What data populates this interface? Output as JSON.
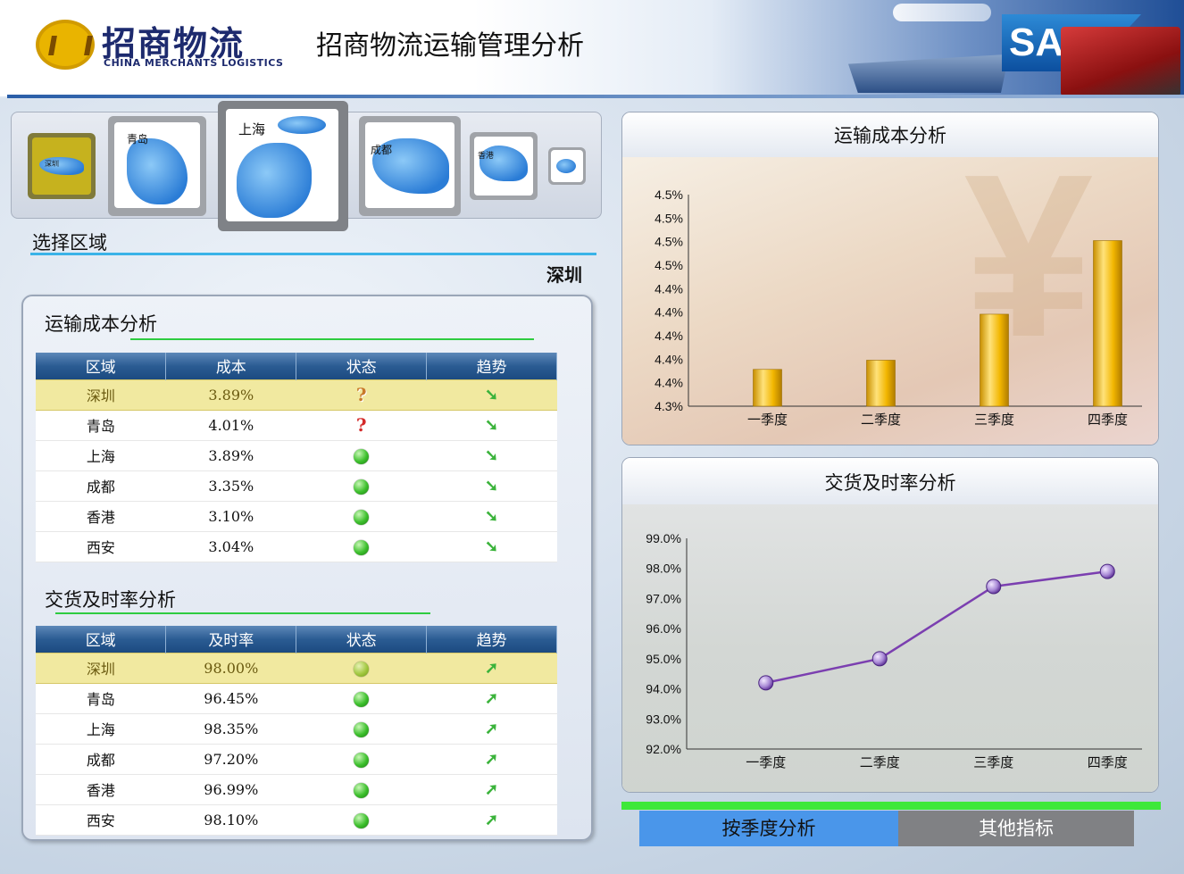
{
  "header": {
    "logo_cn": "招商物流",
    "logo_en": "CHINA MERCHANTS LOGISTICS",
    "title": "招商物流运输管理分析",
    "sap_logo": "SAP"
  },
  "region_selector": {
    "regions": [
      {
        "name": "深圳",
        "state": "selected"
      },
      {
        "name": "青岛",
        "state": "normal"
      },
      {
        "name": "上海",
        "state": "hover"
      },
      {
        "name": "成都",
        "state": "normal"
      },
      {
        "name": "香港",
        "state": "normal"
      },
      {
        "name": "",
        "state": "normal"
      }
    ],
    "label": "选择区域",
    "current": "深圳"
  },
  "cost_section": {
    "title": "运输成本分析",
    "columns": [
      "区域",
      "成本",
      "状态",
      "趋势"
    ],
    "rows": [
      {
        "region": "深圳",
        "value": "3.89%",
        "status": "question",
        "trend": "down"
      },
      {
        "region": "青岛",
        "value": "4.01%",
        "status": "question",
        "trend": "down"
      },
      {
        "region": "上海",
        "value": "3.89%",
        "status": "ok",
        "trend": "down"
      },
      {
        "region": "成都",
        "value": "3.35%",
        "status": "ok",
        "trend": "down"
      },
      {
        "region": "香港",
        "value": "3.10%",
        "status": "ok",
        "trend": "down"
      },
      {
        "region": "西安",
        "value": "3.04%",
        "status": "ok",
        "trend": "down"
      }
    ]
  },
  "delivery_section": {
    "title": "交货及时率分析",
    "columns": [
      "区域",
      "及时率",
      "状态",
      "趋势"
    ],
    "rows": [
      {
        "region": "深圳",
        "value": "98.00%",
        "status": "ok",
        "trend": "up"
      },
      {
        "region": "青岛",
        "value": "96.45%",
        "status": "ok",
        "trend": "up"
      },
      {
        "region": "上海",
        "value": "98.35%",
        "status": "ok",
        "trend": "up"
      },
      {
        "region": "成都",
        "value": "97.20%",
        "status": "ok",
        "trend": "up"
      },
      {
        "region": "香港",
        "value": "96.99%",
        "status": "ok",
        "trend": "up"
      },
      {
        "region": "西安",
        "value": "98.10%",
        "status": "ok",
        "trend": "up"
      }
    ]
  },
  "chart_data": [
    {
      "type": "bar",
      "title": "运输成本分析",
      "categories": [
        "一季度",
        "二季度",
        "三季度",
        "四季度"
      ],
      "values": [
        4.36,
        4.37,
        4.42,
        4.5
      ],
      "ytick_labels": [
        "4.3%",
        "4.4%",
        "4.4%",
        "4.4%",
        "4.4%",
        "4.4%",
        "4.5%",
        "4.5%",
        "4.5%",
        "4.5%"
      ],
      "ylim": [
        4.32,
        4.55
      ],
      "bar_color": "#f2b600"
    },
    {
      "type": "line",
      "title": "交货及时率分析",
      "categories": [
        "一季度",
        "二季度",
        "三季度",
        "四季度"
      ],
      "values": [
        94.2,
        95.0,
        97.4,
        97.9
      ],
      "ytick_labels": [
        "92.0%",
        "93.0%",
        "94.0%",
        "95.0%",
        "96.0%",
        "97.0%",
        "98.0%",
        "99.0%"
      ],
      "ylim": [
        92,
        99
      ],
      "line_color": "#7b3fb0"
    }
  ],
  "tabs": {
    "active": "按季度分析",
    "other": "其他指标"
  }
}
